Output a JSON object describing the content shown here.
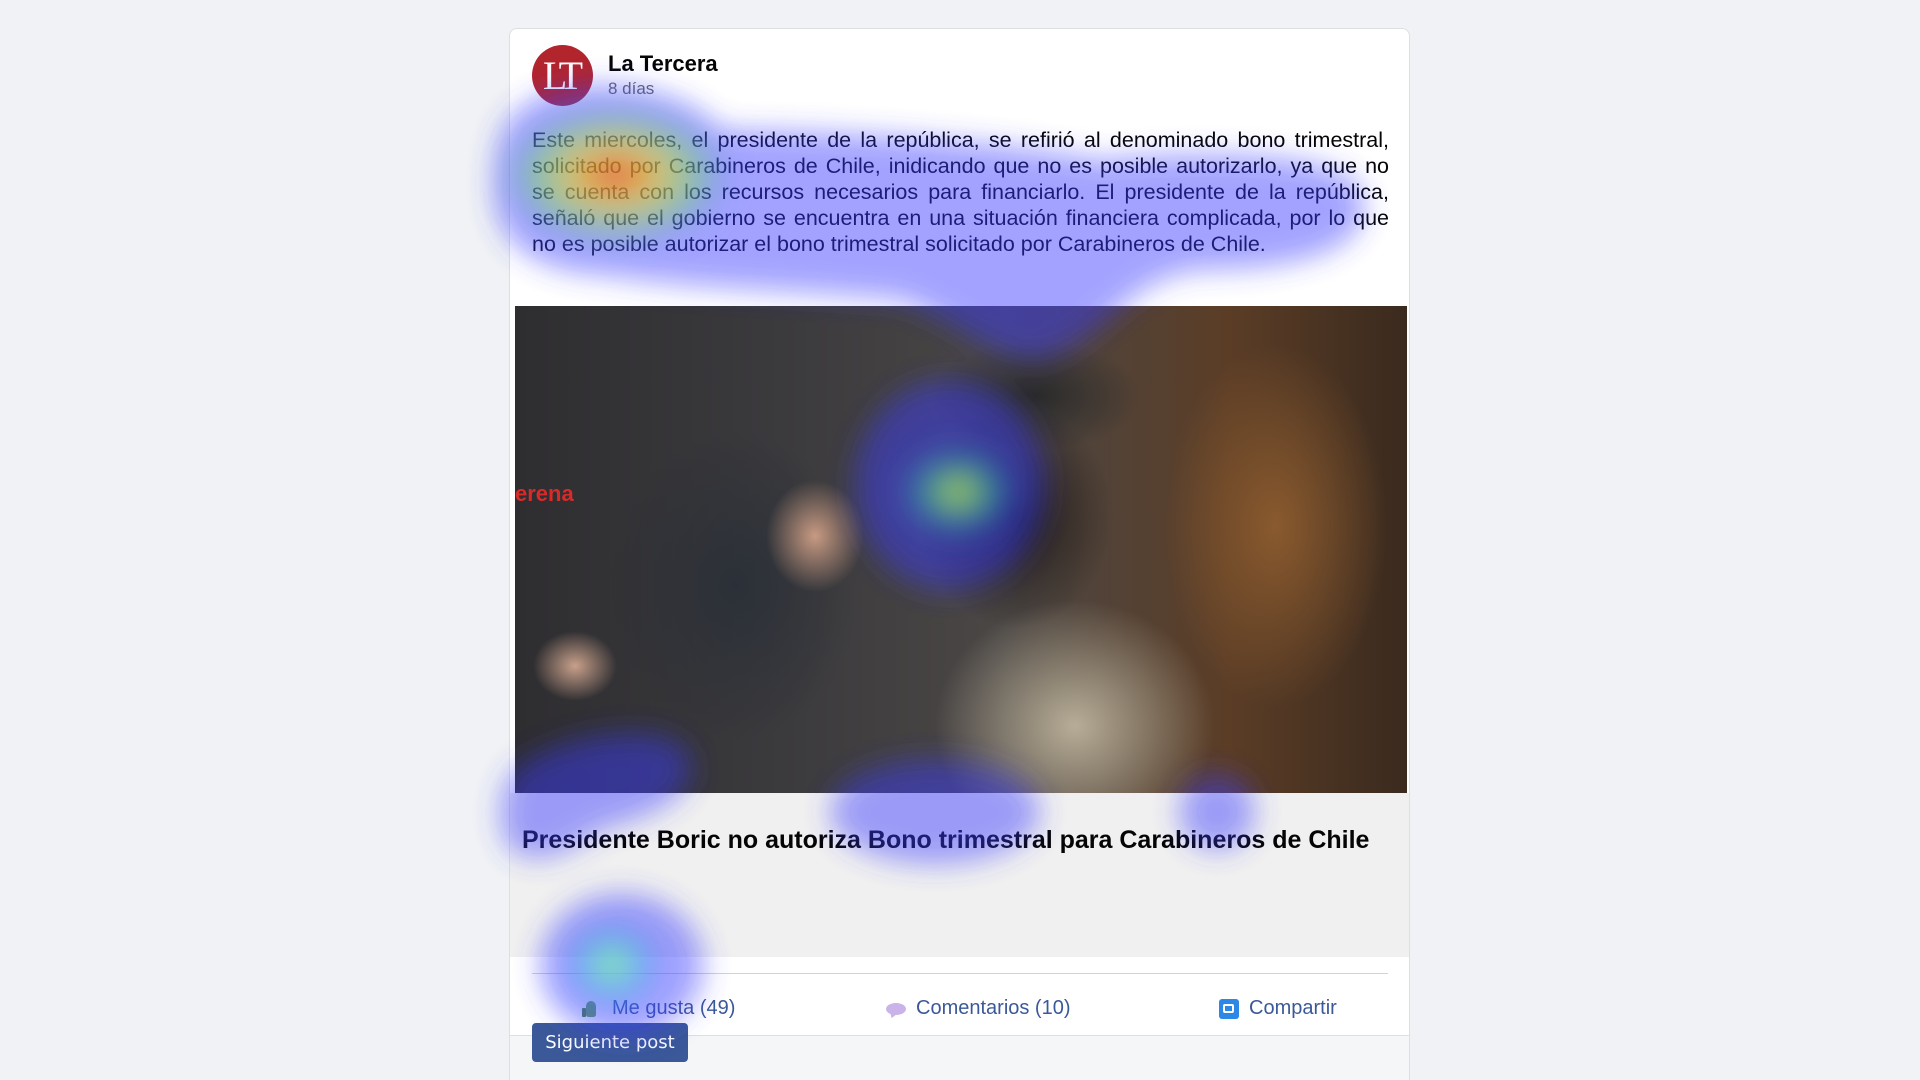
{
  "post": {
    "author": "La Tercera",
    "avatar_initials": "LT",
    "time": "8 días",
    "body": "Este miercoles, el presidente de la república, se refirió al denominado bono trimestral, solicitado por Carabineros de Chile, inidicando que no es posible autorizarlo, ya que no se cuenta con los recursos necesarios para financiarlo. El presidente de la república, señaló que el gobierno se encuentra en una situación financiera complicada, por lo que no es posible autorizar el bono trimestral solicitado por Carabineros de Chile.",
    "photo_watermark": "erena",
    "link_title": "Presidente Boric no autoriza Bono trimestral para Carabineros de Chile"
  },
  "actions": {
    "like_label": "Me gusta (49)",
    "comment_label": "Comentarios (10)",
    "share_label": "Compartir"
  },
  "next_button_label": "Siguiente post",
  "colors": {
    "avatar_red": "#b3252c",
    "link_blue": "#3b5998",
    "share_blue": "#2d88e5"
  }
}
